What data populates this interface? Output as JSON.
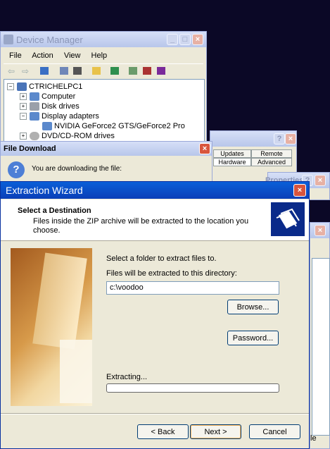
{
  "device_manager": {
    "title": "Device Manager",
    "menu": [
      "File",
      "Action",
      "View",
      "Help"
    ],
    "tree": {
      "root": "CTRICHELPC1",
      "computer": "Computer",
      "disk": "Disk drives",
      "display": "Display adapters",
      "adapter": "NVIDIA GeForce2 GTS/GeForce2 Pro",
      "dvd": "DVD/CD-ROM drives"
    }
  },
  "properties": {
    "tabs": [
      "Updates",
      "Remote",
      "Hardware",
      "Advanced"
    ],
    "partial_title": "Properties"
  },
  "file_download": {
    "title": "File Download",
    "message": "You are downloading the file:"
  },
  "wizard": {
    "title": "Extraction Wizard",
    "header_title": "Select a Destination",
    "header_desc": "Files inside the ZIP archive will be extracted to the location you choose.",
    "prompt": "Select a folder to extract files to.",
    "dir_label": "Files will be extracted to this directory:",
    "dir_value": "c:\\voodoo",
    "browse": "Browse...",
    "password": "Password...",
    "extracting": "Extracting...",
    "progress": 0,
    "back": "< Back",
    "next": "Next >",
    "cancel": "Cancel"
  },
  "bottom_partial": "le"
}
